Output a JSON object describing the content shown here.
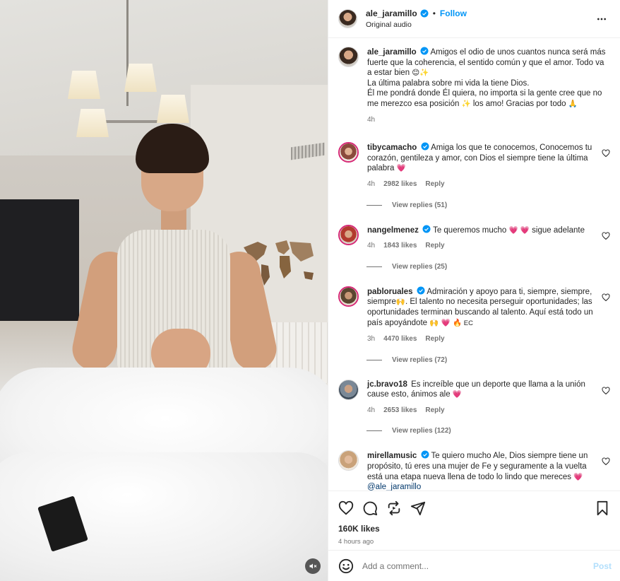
{
  "colors": {
    "accent": "#0095f6",
    "text": "#262626",
    "muted": "#737373",
    "heart": "#ff3040",
    "verified": "#0095f6",
    "post_disabled": "#b2dffc"
  },
  "header": {
    "username": "ale_jaramillo",
    "dot": "•",
    "follow_label": "Follow",
    "audio": "Original audio"
  },
  "caption": {
    "username": "ale_jaramillo",
    "text_1": "Amigos el odio de unos cuantos nunca será más fuerte que la coherencia, el sentido común y que el amor. Todo va a estar bien ",
    "emoji_1": "😊✨",
    "text_2": "La última palabra sobre mi vida la tiene Dios.",
    "text_3": "Él me pondrá donde Él quiera, no importa si la gente cree que no me merezco esa posición ",
    "emoji_2": "✨",
    "text_4": " los amo! Gracias por todo ",
    "emoji_3": "🙏",
    "time": "4h"
  },
  "comments": [
    {
      "username": "tibycamacho",
      "text": "Amiga los que te conocemos, Conocemos tu corazón, gentileza y amor, con Dios el siempre tiene la última palabra ",
      "emoji": "💗",
      "time": "4h",
      "likes": "2982 likes",
      "reply": "Reply",
      "view_replies": "View replies (51)",
      "avatar_color": "#8a4a3c"
    },
    {
      "username": "nangelmenez",
      "text": "Te queremos mucho ",
      "emoji": "💗 💗",
      "text_after": " sigue adelante",
      "time": "4h",
      "likes": "1843 likes",
      "reply": "Reply",
      "view_replies": "View replies (25)",
      "avatar_color": "#b23a2e"
    },
    {
      "username": "pabloruales",
      "text": "Admiración y apoyo para ti, siempre, siempre, siempre",
      "emoji": "🙌",
      "text_after": ". El talento no necesita perseguir oportunidades; las oportunidades terminan buscando al talento. Aquí está todo un país apoyándote ",
      "emoji_2": "🙌 💗 🔥",
      "text_end": " EC",
      "time": "3h",
      "likes": "4470 likes",
      "reply": "Reply",
      "view_replies": "View replies (72)",
      "avatar_color": "#5a4630"
    },
    {
      "username": "jc.bravo18",
      "text": "Es increíble que un deporte que llama a la unión cause esto, ánimos ale ",
      "emoji": "💗",
      "time": "4h",
      "likes": "2653 likes",
      "reply": "Reply",
      "view_replies": "View replies (122)",
      "avatar_color": "#7a8896"
    },
    {
      "username": "mirellamusic",
      "text": "Te quiero mucho Ale, Dios siempre tiene un propósito, tú eres una mujer de Fe y seguramente a la vuelta está una etapa nueva llena de todo lo lindo que mereces ",
      "emoji": "💗",
      "mention": "@ale_jaramillo",
      "avatar_color": "#c9a27a"
    }
  ],
  "actions": {
    "likes": "160K likes",
    "ago": "4 hours ago"
  },
  "add_comment": {
    "placeholder": "Add a comment...",
    "post_label": "Post"
  }
}
